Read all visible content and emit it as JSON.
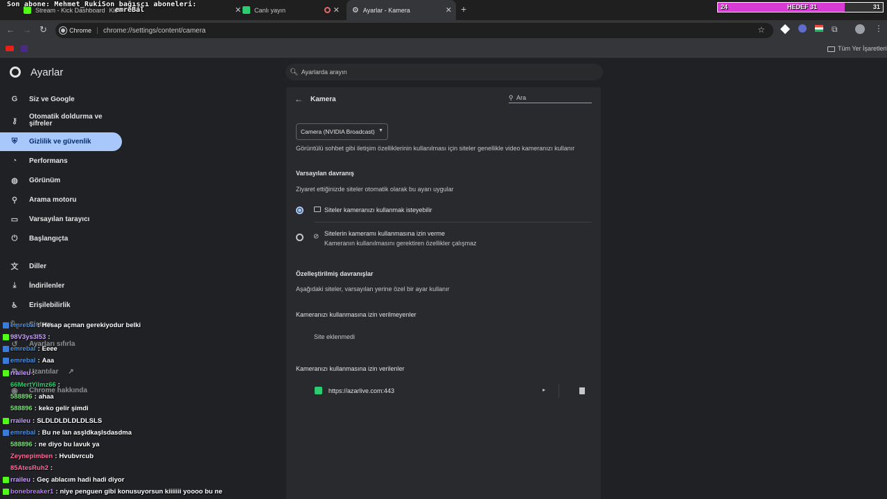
{
  "overlay": {
    "top_line": "Son abone: Mehmet_RukiSon bağışçı aboneleri:",
    "top_line2": "emreBal",
    "goal_left": "24",
    "goal_label": "HEDEF 31",
    "goal_right": "31",
    "goal_progress": 0.77
  },
  "tabs": [
    {
      "label": "Stream - Kick Dashboard",
      "extra": "Kick"
    },
    {
      "label": "Canlı yayın"
    },
    {
      "label": ""
    },
    {
      "label": "Ayarlar - Kamera"
    }
  ],
  "toolbar": {
    "chip": "Chrome",
    "url": "chrome://settings/content/camera",
    "bookmarks_all": "Tüm Yer İşaretleri"
  },
  "settings": {
    "title": "Ayarlar",
    "search_placeholder": "Ayarlarda arayın",
    "nav": [
      {
        "label": "Siz ve Google",
        "icon": "google-icon"
      },
      {
        "label": "Otomatik doldurma ve şifreler",
        "icon": "key-icon"
      },
      {
        "label": "Gizlilik ve güvenlik",
        "icon": "shield-icon"
      },
      {
        "label": "Performans",
        "icon": "speedometer-icon"
      },
      {
        "label": "Görünüm",
        "icon": "palette-icon"
      },
      {
        "label": "Arama motoru",
        "icon": "search-icon"
      },
      {
        "label": "Varsayılan tarayıcı",
        "icon": "browser-icon"
      },
      {
        "label": "Başlangıçta",
        "icon": "power-icon"
      },
      {
        "label": "Diller",
        "icon": "translate-icon"
      },
      {
        "label": "İndirilenler",
        "icon": "download-icon"
      },
      {
        "label": "Erişilebilirlik",
        "icon": "accessibility-icon"
      },
      {
        "label": "Sistem",
        "icon": "wrench-icon"
      },
      {
        "label": "Ayarları sıfırla",
        "icon": "reset-icon"
      },
      {
        "label": "Uzantılar",
        "icon": "puzzle-icon"
      },
      {
        "label": "Chrome hakkında",
        "icon": "chrome-icon"
      }
    ]
  },
  "camera": {
    "title": "Kamera",
    "search_placeholder": "Ara",
    "device": "Camera (NVIDIA Broadcast)",
    "device_desc": "Görüntülü sohbet gibi iletişim özelliklerinin kullanılması için siteler genellikle video kameranızı kullanır",
    "default_heading": "Varsayılan davranış",
    "default_desc": "Ziyaret ettiğinizde siteler otomatik olarak bu ayarı uygular",
    "option_allow": "Siteler kameranızı kullanmak isteyebilir",
    "option_block": "Sitelerin kameramı kullanmasına izin verme",
    "option_block_sub": "Kameranın kullanılmasını gerektiren özellikler çalışmaz",
    "custom_heading": "Özelleştirilmiş davranışlar",
    "custom_desc": "Aşağıdaki siteler, varsayılan yerine özel bir ayar kullanır",
    "blocked_heading": "Kameranızı kullanmasına izin verilmeyenler",
    "blocked_empty": "Site eklenmedi",
    "allowed_heading": "Kameranızı kullanmasına izin verilenler",
    "allowed_site": "https://azarlive.com:443"
  },
  "chat": [
    {
      "user": "emrebal",
      "msg": "Hesap açman gerekiyodur belki",
      "color": "#4a90e2"
    },
    {
      "user": "98V3ys3l53",
      "msg": "",
      "color": "#c9a0ff"
    },
    {
      "user": "emrebal",
      "msg": "Eeee",
      "color": "#4a90e2"
    },
    {
      "user": "emrebal",
      "msg": "Aaa",
      "color": "#4a90e2"
    },
    {
      "user": "rraileu",
      "msg": "",
      "color": "#c9a0ff"
    },
    {
      "user": "66MertYilmz66",
      "msg": "",
      "color": "#2ecc71"
    },
    {
      "user": "588896",
      "msg": "ahaa",
      "color": "#7be07b"
    },
    {
      "user": "588896",
      "msg": "keko gelir şimdi",
      "color": "#7be07b"
    },
    {
      "user": "rraileu",
      "msg": "SLDLDLDLDLDLSLS",
      "color": "#c9a0ff"
    },
    {
      "user": "emrebal",
      "msg": "Bu ne lan asşldkaşlsdasdma",
      "color": "#4a90e2"
    },
    {
      "user": "588896",
      "msg": "ne diyo bu lavuk ya",
      "color": "#7be07b"
    },
    {
      "user": "Zeynepimben",
      "msg": "Hvubvrcub",
      "color": "#ff6b9d"
    },
    {
      "user": "85AtesRuh2",
      "msg": "",
      "color": "#ff6b9d"
    },
    {
      "user": "rraileu",
      "msg": "Geç ablacım hadi hadi diyor",
      "color": "#c9a0ff"
    },
    {
      "user": "bonebreaker1",
      "msg": "niye penguen gibi konusuyorsun kiiiiiii yoooo bu ne",
      "color": "#b77cff"
    }
  ]
}
